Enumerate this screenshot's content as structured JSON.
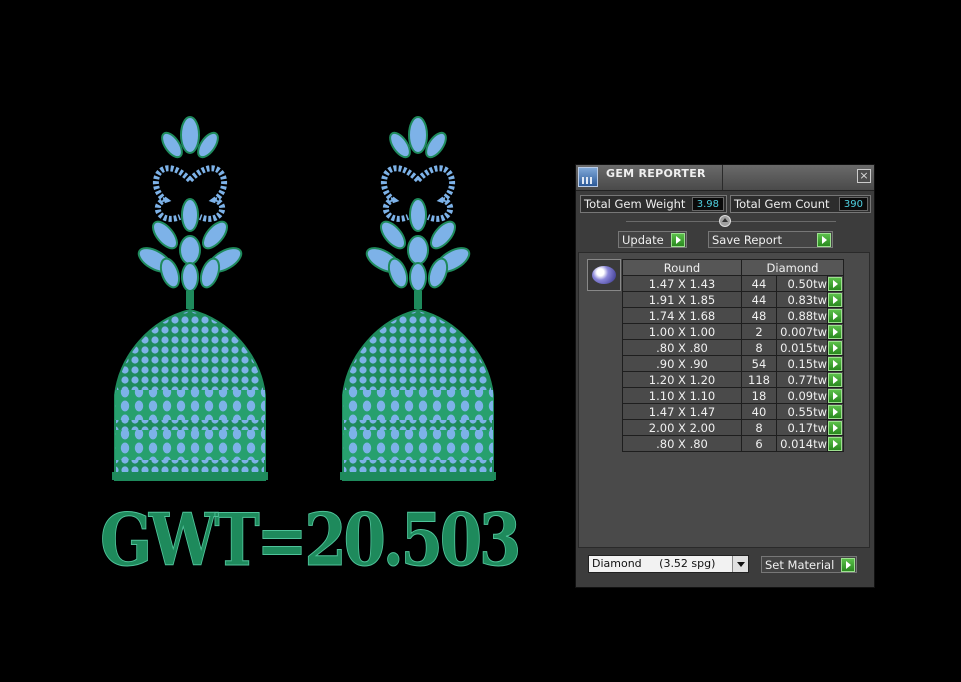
{
  "canvas": {
    "gwt_label": "GWT=20.503",
    "colors": {
      "metal": "#1e8a5c",
      "gem": "#7db2e8",
      "background": "#000000"
    }
  },
  "panel": {
    "title": "GEM REPORTER",
    "total_gem_weight_label": "Total Gem Weight",
    "total_gem_weight": "3.98",
    "total_gem_count_label": "Total Gem Count",
    "total_gem_count": "390",
    "update_label": "Update",
    "save_report_label": "Save Report",
    "table": {
      "shape_header": "Round",
      "material_header": "Diamond",
      "rows": [
        {
          "size": "1.47 X 1.43",
          "count": "44",
          "weight": "0.50tw"
        },
        {
          "size": "1.91 X 1.85",
          "count": "44",
          "weight": "0.83tw"
        },
        {
          "size": "1.74 X 1.68",
          "count": "48",
          "weight": "0.88tw"
        },
        {
          "size": "1.00 X 1.00",
          "count": "2",
          "weight": "0.007tw"
        },
        {
          "size": ".80 X .80",
          "count": "8",
          "weight": "0.015tw"
        },
        {
          "size": ".90 X .90",
          "count": "54",
          "weight": "0.15tw"
        },
        {
          "size": "1.20 X 1.20",
          "count": "118",
          "weight": "0.77tw"
        },
        {
          "size": "1.10 X 1.10",
          "count": "18",
          "weight": "0.09tw"
        },
        {
          "size": "1.47 X 1.47",
          "count": "40",
          "weight": "0.55tw"
        },
        {
          "size": "2.00 X 2.00",
          "count": "8",
          "weight": "0.17tw"
        },
        {
          "size": ".80 X .80",
          "count": "6",
          "weight": "0.014tw"
        }
      ]
    },
    "material_select": "Diamond     (3.52 spg)",
    "set_material_label": "Set Material",
    "icons": {
      "app": "gem-reporter-app-icon",
      "close": "close-icon",
      "go": "green-play-icon",
      "collapse": "collapse-arrow-icon",
      "dropdown": "chevron-down-icon"
    }
  }
}
